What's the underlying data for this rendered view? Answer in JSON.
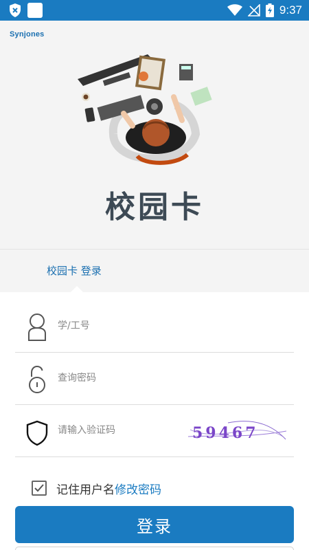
{
  "status_bar": {
    "time": "9:37",
    "icons": [
      "shield-x-icon",
      "notification-square-icon",
      "wifi-icon",
      "no-signal-icon",
      "battery-charging-icon"
    ]
  },
  "brand": {
    "logo_text": "Synjones"
  },
  "banner": {
    "illustration": "desk-workspace-illustration",
    "app_title": "校园卡"
  },
  "tab": {
    "label": "校园卡 登录"
  },
  "form": {
    "username": {
      "placeholder": "学/工号",
      "value": "",
      "icon": "user-icon"
    },
    "password": {
      "placeholder": "查询密码",
      "value": "",
      "icon": "lock-icon"
    },
    "captcha": {
      "placeholder": "请输入验证码",
      "value": "",
      "icon": "shield-icon",
      "image_text": "59467"
    },
    "remember_label": "记住用户名",
    "remember_checked": true,
    "change_password_link": "修改密码",
    "login_button": "登录"
  },
  "colors": {
    "primary": "#1a7bc1",
    "title": "#3d4a55",
    "captcha_ink": "#7a45c8"
  }
}
